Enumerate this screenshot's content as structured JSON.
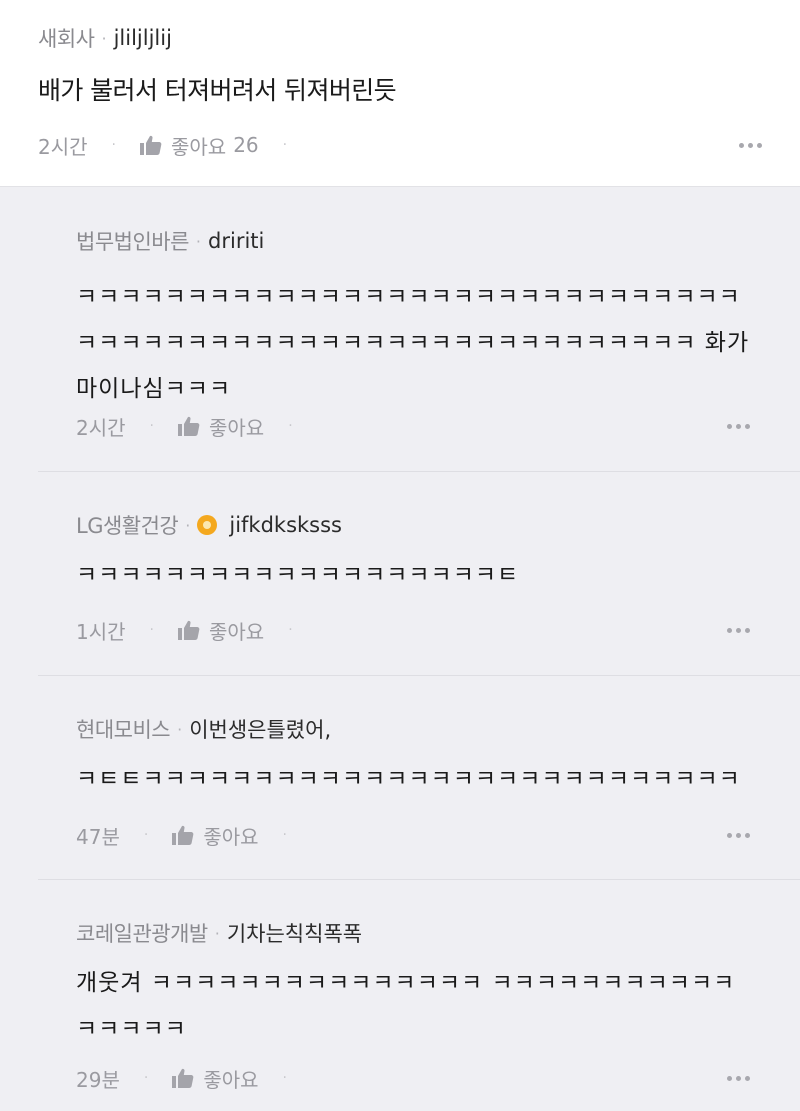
{
  "post": {
    "company": "새회사",
    "user": "jliljljlij",
    "text": "배가 불러서 터져버려서 뒤져버린듯",
    "time": "2시간",
    "like_label": "좋아요",
    "like_count": "26"
  },
  "replies": [
    {
      "company": "법무법인바른",
      "user": "dririti",
      "text": "ㅋㅋㅋㅋㅋㅋㅋㅋㅋㅋㅋㅋㅋㅋㅋㅋㅋㅋㅋㅋㅋㅋㅋㅋㅋㅋㅋㅋㅋㅋㅋㅋㅋㅋㅋㅋㅋㅋㅋㅋㅋㅋㅋㅋㅋㅋㅋㅋㅋㅋㅋㅋㅋㅋㅋㅋㅋㅋ 화가 마이나심ㅋㅋㅋ",
      "time": "2시간",
      "like_label": "좋아요"
    },
    {
      "company": "LG생활건강",
      "user": "jifkdksksss",
      "text": "ㅋㅋㅋㅋㅋㅋㅋㅋㅋㅋㅋㅋㅋㅋㅋㅋㅋㅋㅋㅌ",
      "time": "1시간",
      "like_label": "좋아요"
    },
    {
      "company": "현대모비스",
      "user": "이번생은틀렸어,",
      "text": "ㅋㅌㅌㅋㅋㅋㅋㅋㅋㅋㅋㅋㅋㅋㅋㅋㅋㅋㅋㅋㅋㅋㅋㅋㅋㅋㅋㅋㅋㅋ",
      "time": "47분",
      "like_label": "좋아요"
    },
    {
      "company": "코레일관광개발",
      "user": "기차는칙칙폭폭",
      "text": "개웃겨 ㅋㅋㅋㅋㅋㅋㅋㅋㅋㅋㅋㅋㅋㅋㅋ ㅋㅋㅋㅋㅋㅋㅋㅋㅋㅋㅋㅋㅋㅋㅋㅋ",
      "time": "29분",
      "like_label": "좋아요"
    }
  ]
}
